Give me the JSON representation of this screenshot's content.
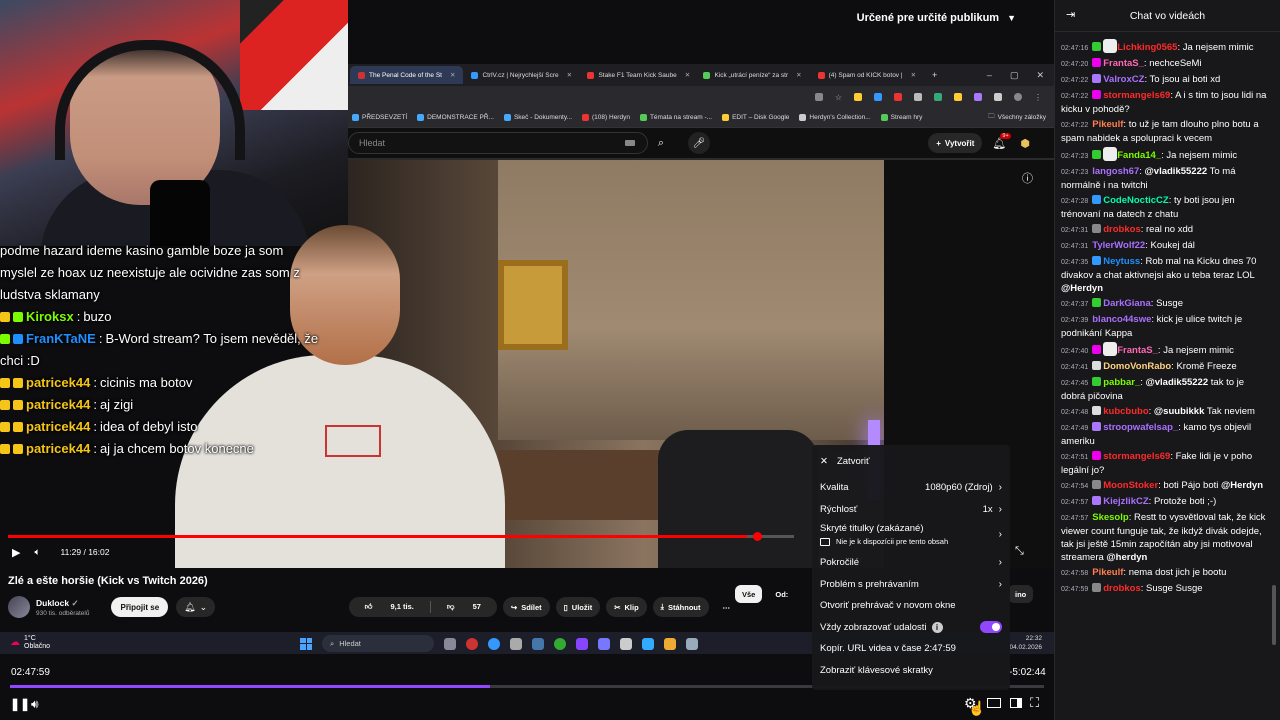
{
  "stage_header": {
    "audience_label": "Určené pre určité publikum"
  },
  "browser": {
    "tabs": [
      {
        "label": "The Penal Code of the St",
        "color": "#c33",
        "active": true
      },
      {
        "label": "CtrlV.cz | Nejrychlejší Scre",
        "color": "#39f",
        "active": false
      },
      {
        "label": "Stake F1 Team Kick Saube",
        "color": "#e33",
        "active": false
      },
      {
        "label": "Kick „utrácí peníze“ za str",
        "color": "#5c5",
        "active": false
      },
      {
        "label": "(4) Spam od KICK botov |",
        "color": "#e33",
        "active": false
      }
    ],
    "new_tab": "+",
    "window_buttons": [
      "–",
      "▢",
      "✕"
    ],
    "bookmarks": [
      {
        "label": "PŘEDSEVZETÍ",
        "color": "#4af"
      },
      {
        "label": "DEMONSTRACE PŘ...",
        "color": "#4af"
      },
      {
        "label": "Skeč - Dokumenty...",
        "color": "#4af"
      },
      {
        "label": "(108) Herdyn",
        "color": "#e33"
      },
      {
        "label": "Témata na stream -...",
        "color": "#5c5"
      },
      {
        "label": "EDIT – Disk Google",
        "color": "#fc3"
      },
      {
        "label": "Herdyn's Collection...",
        "color": "#ccc"
      },
      {
        "label": "Stream hry",
        "color": "#5c5"
      }
    ],
    "bookmarks_all": "Všechny záložky"
  },
  "yt": {
    "search_placeholder": "Hledat",
    "create_label": "Vytvořit",
    "bell_badge": "9+",
    "time_display": "11:29 / 16:02",
    "video_title": "Zlé a ešte horšie (Kick vs Twitch 2026)",
    "channel_name": "Duklock",
    "channel_verified": "✓",
    "channel_subs": "930 tis. odběratelů",
    "subscribe_label": "Připojit se",
    "likes": "9,1 tis.",
    "dislikes": "57",
    "share_label": "Sdílet",
    "save_label": "Uložit",
    "clip_label": "Klip",
    "download_label": "Stáhnout",
    "more_label": "⋯",
    "chip_all": "Vše",
    "chip_from": "Od:",
    "chip_extra": "ino"
  },
  "overlay_chat": [
    {
      "type": "text",
      "text": "podme hazard ideme kasino gamble boze ja som"
    },
    {
      "type": "text",
      "text": "myslel ze hoax uz neexistuje ale ocividne zas som z"
    },
    {
      "type": "text",
      "text": "ludstva sklamany"
    },
    {
      "type": "msg",
      "user": "Kiroksx",
      "color": "#7cfc00",
      "text": "buzo"
    },
    {
      "type": "msg",
      "user": "FranKTaNE",
      "color": "#1e90ff",
      "text": "B-Word stream? To jsem nevěděl, že"
    },
    {
      "type": "text",
      "text": "chci :D"
    },
    {
      "type": "msg",
      "user": "patricek44",
      "color": "#f5c518",
      "text": "cicinis ma botov"
    },
    {
      "type": "msg",
      "user": "patricek44",
      "color": "#f5c518",
      "text": "aj zigi"
    },
    {
      "type": "msg",
      "user": "patricek44",
      "color": "#f5c518",
      "text": "idea of debyl isto"
    },
    {
      "type": "msg",
      "user": "patricek44",
      "color": "#f5c518",
      "text": "aj ja chcem botov konecne"
    }
  ],
  "taskbar": {
    "temp": "1°C",
    "weather": "Oblačno",
    "search_placeholder": "Hledat",
    "clock_time": "22:32",
    "clock_date": "04.02.2026"
  },
  "player": {
    "elapsed": "02:47:59",
    "remaining": "-5:02:44",
    "progress": 0.464
  },
  "settings_menu": {
    "close_label": "Zatvoriť",
    "quality_label": "Kvalita",
    "quality_value": "1080p60 (Zdroj)",
    "speed_label": "Rýchlosť",
    "speed_value": "1x",
    "cc_label": "Skryté titulky (zakázané)",
    "cc_sub": "Nie je k dispozícii pre tento obsah",
    "advanced_label": "Pokročilé",
    "problem_label": "Problém s prehrávaním",
    "open_new_window": "Otvoriť prehrávač v novom okne",
    "always_show_events": "Vždy zobrazovať udalosti",
    "copy_url": "Kopír. URL videa v čase 2:47:59",
    "shortcuts": "Zobraziť klávesové skratky"
  },
  "chat": {
    "title": "Chat vo videách",
    "messages": [
      {
        "ts": "02:47:16",
        "user": "Lichking0565",
        "color": "#ff2a2a",
        "badge": "#3c3",
        "text": "Ja nejsem mimic",
        "emote": true
      },
      {
        "ts": "02:47:20",
        "user": "FrantaS_",
        "color": "#ff69b4",
        "badge": "#e0e",
        "text": "nechceSeMi"
      },
      {
        "ts": "02:47:22",
        "user": "ValroxCZ",
        "color": "#a970ff",
        "badge": "#a7f",
        "text": "To jsou ai boti xd"
      },
      {
        "ts": "02:47:22",
        "user": "stormangels69",
        "color": "#ff2a2a",
        "badge": "#e0e",
        "text": "A i s tim to jsou lidi na kicku v pohodě?"
      },
      {
        "ts": "02:47:22",
        "user": "Pikeulf",
        "color": "#ff7f50",
        "badge": "",
        "text": "to už je tam dlouho plno botu a spam nabidek a spolupraci k vecem"
      },
      {
        "ts": "02:47:23",
        "user": "Fanda14_",
        "color": "#7cfc00",
        "badge": "#3c3",
        "text": "Ja nejsem mimic",
        "emote": true
      },
      {
        "ts": "02:47:23",
        "user": "langosh67",
        "color": "#a970ff",
        "badge": "",
        "text": "To má normálně i na twitchi",
        "mention": "@vladik55222"
      },
      {
        "ts": "02:47:28",
        "user": "CodeNocticCZ",
        "color": "#00ffaa",
        "badge": "#39f",
        "text": "ty boti jsou jen trénovaní na datech z chatu"
      },
      {
        "ts": "02:47:31",
        "user": "drobkos",
        "color": "#ff2a2a",
        "badge": "#888",
        "text": "real no xdd"
      },
      {
        "ts": "02:47:31",
        "user": "TylerWolf22",
        "color": "#a970ff",
        "badge": "",
        "text": "Koukej dál"
      },
      {
        "ts": "02:47:35",
        "user": "Neytuss",
        "color": "#1e90ff",
        "badge": "#39f",
        "text": "Rob mal na Kicku dnes 70 divakov a chat aktivnejsi ako u teba teraz LOL",
        "mention_end": "@Herdyn"
      },
      {
        "ts": "02:47:37",
        "user": "DarkGiana",
        "color": "#a970ff",
        "badge": "#3c3",
        "text": "Susge"
      },
      {
        "ts": "02:47:39",
        "user": "blanco44swe",
        "color": "#a970ff",
        "badge": "",
        "text": "kick je ulice twitch je podnikání Kappa"
      },
      {
        "ts": "02:47:40",
        "user": "FrantaS_",
        "color": "#ff69b4",
        "badge": "#e0e",
        "text": "Ja nejsem mimic",
        "emote": true
      },
      {
        "ts": "02:47:41",
        "user": "DomoVonRabo",
        "color": "#ffd27f",
        "badge": "#ddd",
        "text": "Kromě Freeze"
      },
      {
        "ts": "02:47:45",
        "user": "pabbar_",
        "color": "#7cfc00",
        "badge": "#3c3",
        "text": "tak to je dobrá pičovina",
        "mention": "@vladik55222"
      },
      {
        "ts": "02:47:48",
        "user": "kubcbubo",
        "color": "#ff2a2a",
        "badge": "#ddd",
        "text": "Tak neviem",
        "mention": "@suubikkk"
      },
      {
        "ts": "02:47:49",
        "user": "stroopwafelsap_",
        "color": "#a970ff",
        "badge": "#a7f",
        "text": "kamo tys objevil ameriku"
      },
      {
        "ts": "02:47:51",
        "user": "stormangels69",
        "color": "#ff2a2a",
        "badge": "#e0e",
        "text": "Fake lidi je v poho legální jo?"
      },
      {
        "ts": "02:47:54",
        "user": "MoonStoker",
        "color": "#ff2a2a",
        "badge": "#888",
        "text": "boti Pájo boti",
        "mention_end": "@Herdyn"
      },
      {
        "ts": "02:47:57",
        "user": "KiejzlikCZ",
        "color": "#a970ff",
        "badge": "#a7f",
        "text": "Protože boti ;-)"
      },
      {
        "ts": "02:47:57",
        "user": "Skesolp",
        "color": "#7cfc00",
        "badge": "",
        "text": "Restt to vysvětloval tak, že kick viewer count funguje tak, že ikdyž divák odejde, tak jsi ještě 15min započítán aby jsi motivoval streamera",
        "mention_end": "@herdyn"
      },
      {
        "ts": "02:47:58",
        "user": "Pikeulf",
        "color": "#ff7f50",
        "badge": "",
        "text": "nema dost jich je bootu"
      },
      {
        "ts": "02:47:59",
        "user": "drobkos",
        "color": "#ff2a2a",
        "badge": "#888",
        "text": "Susge Susge"
      }
    ]
  },
  "colors": {
    "accent": "#9147ff",
    "yt_red": "#ff0000"
  }
}
